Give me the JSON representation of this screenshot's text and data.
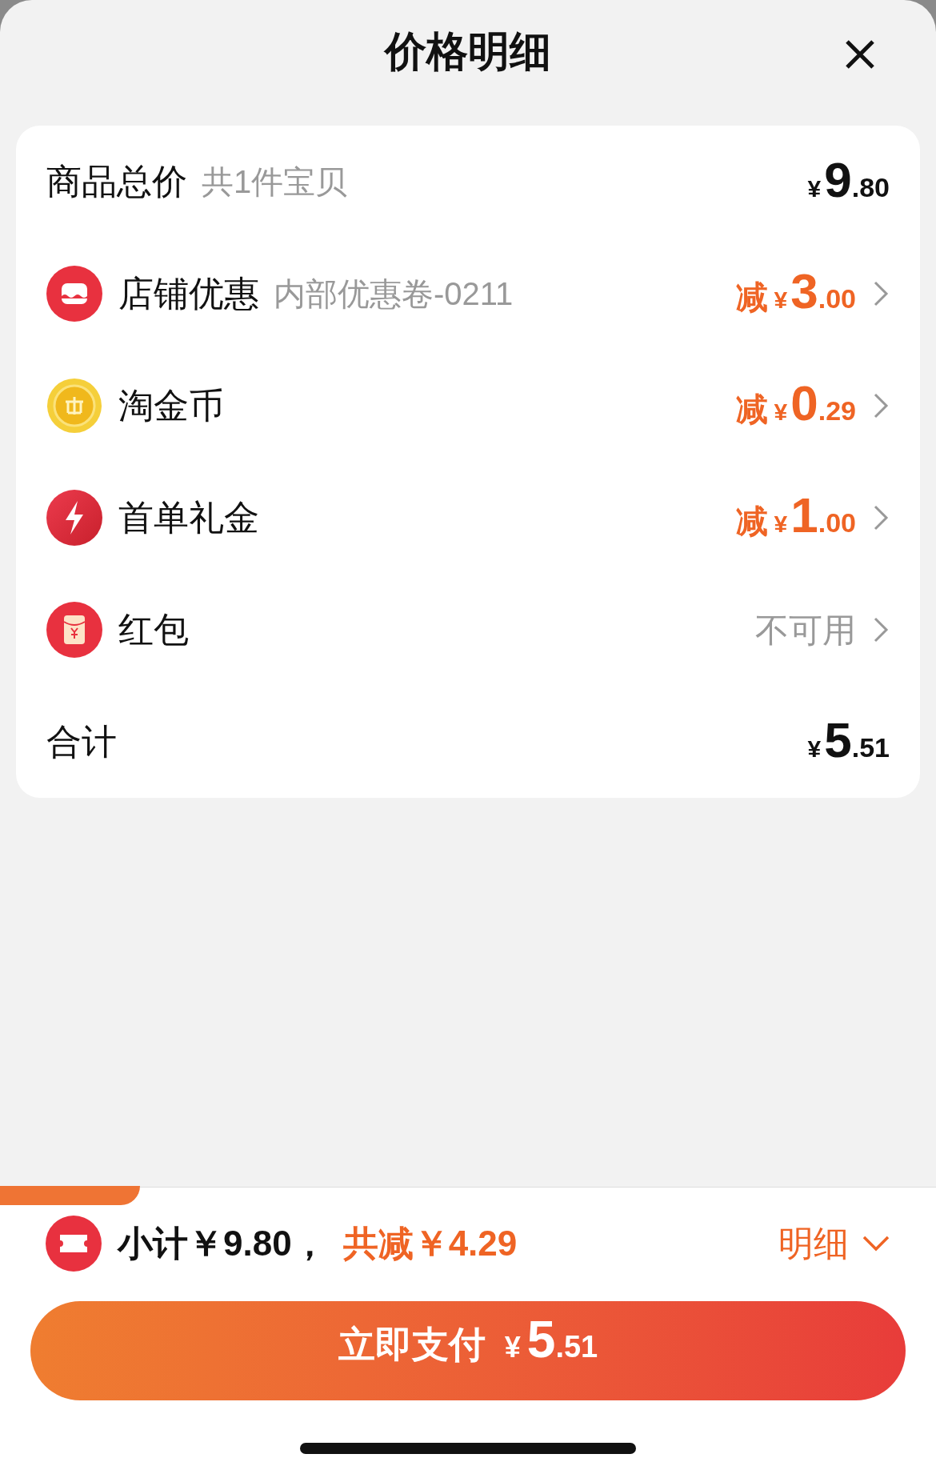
{
  "title": "价格明细",
  "rows": [
    {
      "kind": "summary",
      "label": "商品总价",
      "note": "共1件宝贝",
      "amount": {
        "currency": "¥",
        "integer": "9",
        "decimal": ".80"
      }
    },
    {
      "kind": "discount",
      "label": "店铺优惠",
      "note": "内部优惠卷-0211",
      "amount": {
        "prefix": "减",
        "currency": "¥",
        "integer": "3",
        "decimal": ".00"
      }
    },
    {
      "kind": "discount",
      "label": "淘金币",
      "amount": {
        "prefix": "减",
        "currency": "¥",
        "integer": "0",
        "decimal": ".29"
      }
    },
    {
      "kind": "discount",
      "label": "首单礼金",
      "amount": {
        "prefix": "减",
        "currency": "¥",
        "integer": "1",
        "decimal": ".00"
      }
    },
    {
      "kind": "status",
      "label": "红包",
      "status": "不可用"
    },
    {
      "kind": "summary",
      "label": "合计",
      "amount": {
        "currency": "¥",
        "integer": "5",
        "decimal": ".51"
      }
    }
  ],
  "footer": {
    "subtotal": "小计￥9.80，",
    "saved": "共减￥4.29",
    "details": "明细"
  },
  "pay_button": {
    "label": "立即支付",
    "currency": "¥",
    "integer": "5",
    "decimal": ".51"
  }
}
